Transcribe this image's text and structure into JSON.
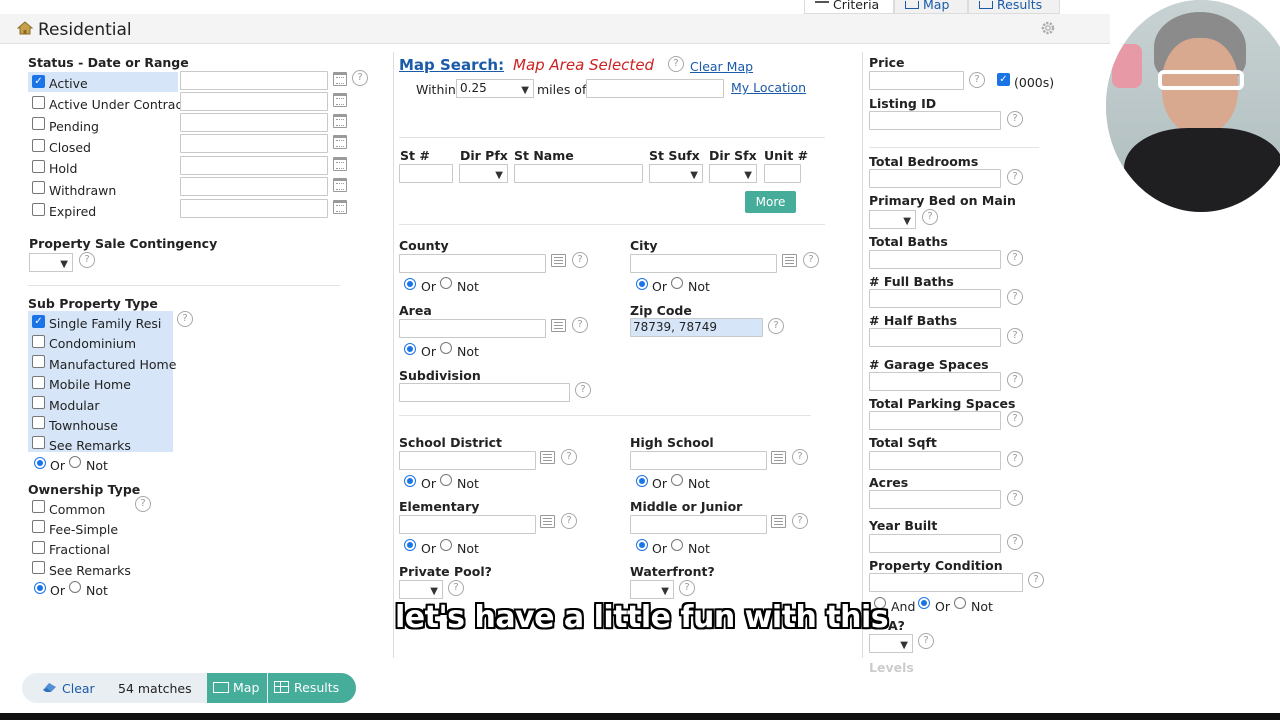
{
  "header": {
    "title": "Residential",
    "tabs": [
      {
        "label": "Criteria"
      },
      {
        "label": "Map"
      },
      {
        "label": "Results"
      }
    ]
  },
  "status": {
    "title": "Status - Date or Range",
    "items": [
      {
        "label": "Active",
        "checked": true
      },
      {
        "label": "Active Under Contract",
        "checked": false
      },
      {
        "label": "Pending",
        "checked": false
      },
      {
        "label": "Closed",
        "checked": false
      },
      {
        "label": "Hold",
        "checked": false
      },
      {
        "label": "Withdrawn",
        "checked": false
      },
      {
        "label": "Expired",
        "checked": false
      }
    ]
  },
  "property_sale_contingency": {
    "title": "Property Sale Contingency"
  },
  "sub_property_type": {
    "title": "Sub Property Type",
    "items": [
      {
        "label": "Single Family Resi",
        "checked": true
      },
      {
        "label": "Condominium",
        "checked": false
      },
      {
        "label": "Manufactured Home",
        "checked": false
      },
      {
        "label": "Mobile Home",
        "checked": false
      },
      {
        "label": "Modular",
        "checked": false
      },
      {
        "label": "Townhouse",
        "checked": false
      },
      {
        "label": "See Remarks",
        "checked": false
      }
    ],
    "or_label": "Or",
    "not_label": "Not"
  },
  "ownership_type": {
    "title": "Ownership Type",
    "items": [
      {
        "label": "Common"
      },
      {
        "label": "Fee-Simple"
      },
      {
        "label": "Fractional"
      },
      {
        "label": "See Remarks"
      }
    ],
    "or_label": "Or",
    "not_label": "Not"
  },
  "map_search": {
    "title": "Map Search:",
    "status": "Map Area Selected",
    "clear_map": "Clear Map",
    "within_label": "Within",
    "within_value": "0.25",
    "miles_of_label": "miles of",
    "my_location": "My Location"
  },
  "street": {
    "st_num": "St #",
    "dir_pfx": "Dir Pfx",
    "st_name": "St Name",
    "st_sufx": "St Sufx",
    "dir_sfx": "Dir Sfx",
    "unit_num": "Unit #",
    "more_button": "More"
  },
  "location": {
    "county": "County",
    "city": "City",
    "area": "Area",
    "zip_code": "Zip Code",
    "zip_value": "78739, 78749",
    "subdivision": "Subdivision",
    "or_label": "Or",
    "not_label": "Not"
  },
  "schools": {
    "school_district": "School District",
    "high_school": "High School",
    "elementary": "Elementary",
    "middle_or_junior": "Middle or Junior"
  },
  "amenities": {
    "private_pool": "Private Pool?",
    "waterfront": "Waterfront?"
  },
  "right_col": {
    "price": "Price",
    "thousands": "(000s)",
    "listing_id": "Listing ID",
    "total_bedrooms": "Total Bedrooms",
    "primary_bed_on_main": "Primary Bed on Main",
    "total_baths": "Total Baths",
    "full_baths": "# Full Baths",
    "half_baths": "# Half Baths",
    "garage_spaces": "# Garage Spaces",
    "total_parking_spaces": "Total Parking Spaces",
    "total_sqft": "Total Sqft",
    "acres": "Acres",
    "year_built": "Year Built",
    "property_condition": "Property Condition",
    "and_label": "And",
    "or_label": "Or",
    "not_label": "Not",
    "hoa_partial": "A?",
    "levels_partial": "Levels"
  },
  "bottom_bar": {
    "clear": "Clear",
    "matches": "54 matches",
    "map": "Map",
    "results": "Results"
  },
  "caption": "let's have a little fun with this",
  "colors": {
    "accent_teal": "#45ad9a",
    "link_blue": "#1a5aa8",
    "map_selected_red": "#cc2222",
    "highlight_blue": "#d6e6f8"
  }
}
